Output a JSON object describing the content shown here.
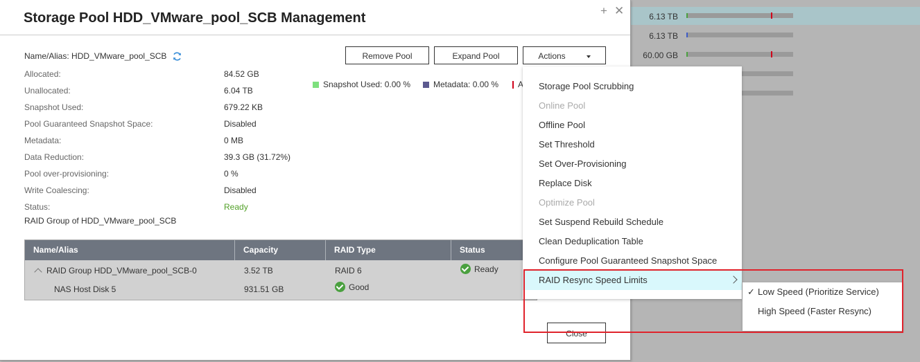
{
  "background": {
    "rows": [
      {
        "size": "6.13 TB",
        "used_color": "#4aa03f",
        "selected": true
      },
      {
        "size": "6.13 TB",
        "used_color": "#3d5bc7",
        "selected": false
      },
      {
        "size": "60.00 GB",
        "used_color": "#4aa03f",
        "selected": false
      },
      {
        "size": "",
        "used_color": "",
        "selected": false
      },
      {
        "size": "",
        "used_color": "",
        "selected": false
      }
    ]
  },
  "dialog": {
    "title": "Storage Pool HDD_VMware_pool_SCB Management",
    "name_alias": "Name/Alias: HDD_VMware_pool_SCB",
    "buttons": {
      "remove": "Remove Pool",
      "expand": "Expand Pool",
      "actions": "Actions",
      "close": "Close"
    },
    "info": [
      {
        "label": "Allocated:",
        "value": "84.52 GB"
      },
      {
        "label": "Unallocated:",
        "value": "6.04 TB"
      },
      {
        "label": "Snapshot Used:",
        "value": "679.22 KB"
      },
      {
        "label": "Pool Guaranteed Snapshot Space:",
        "value": "Disabled"
      },
      {
        "label": "Metadata:",
        "value": "0 MB"
      },
      {
        "label": "Data Reduction:",
        "value": "39.3 GB (31.72%)"
      },
      {
        "label": "Pool over-provisioning:",
        "value": "0 %"
      },
      {
        "label": "Write Coalescing:",
        "value": "Disabled"
      },
      {
        "label": "Status:",
        "value": "Ready"
      }
    ],
    "legend": [
      {
        "label": "Snapshot Used: 0.00 %",
        "color": "#7ee07e"
      },
      {
        "label": "Metadata: 0.00 %",
        "color": "#5c5a8f"
      },
      {
        "label": "A",
        "color": "#d0021b"
      }
    ],
    "raid_heading": "RAID Group of HDD_VMware_pool_SCB",
    "table": {
      "columns": [
        "Name/Alias",
        "Capacity",
        "RAID Type",
        "Status"
      ],
      "rows": [
        {
          "name": "RAID Group HDD_VMware_pool_SCB-0",
          "capacity": "3.52 TB",
          "raid_type": "RAID 6",
          "status": "Ready"
        },
        {
          "name": "NAS Host Disk 5",
          "capacity": "931.51 GB",
          "raid_type": "Good",
          "status": ""
        }
      ]
    }
  },
  "actions_menu": {
    "items": [
      {
        "label": "Storage Pool Scrubbing",
        "disabled": false
      },
      {
        "label": "Online Pool",
        "disabled": true
      },
      {
        "label": "Offline Pool",
        "disabled": false
      },
      {
        "label": "Set Threshold",
        "disabled": false
      },
      {
        "label": "Set Over-Provisioning",
        "disabled": false
      },
      {
        "label": "Replace Disk",
        "disabled": false
      },
      {
        "label": "Optimize Pool",
        "disabled": true
      },
      {
        "label": "Set Suspend Rebuild Schedule",
        "disabled": false
      },
      {
        "label": "Clean Deduplication Table",
        "disabled": false
      },
      {
        "label": "Configure Pool Guaranteed Snapshot Space",
        "disabled": false
      },
      {
        "label": "RAID Resync Speed Limits",
        "disabled": false
      }
    ],
    "submenu": [
      {
        "label": "Low Speed (Prioritize Service)",
        "checked": true
      },
      {
        "label": "High Speed (Faster Resync)",
        "checked": false
      }
    ]
  },
  "colors": {
    "accent_hover": "#d9f8fc",
    "highlight_box": "#e0222b",
    "ready": "#52a028"
  }
}
